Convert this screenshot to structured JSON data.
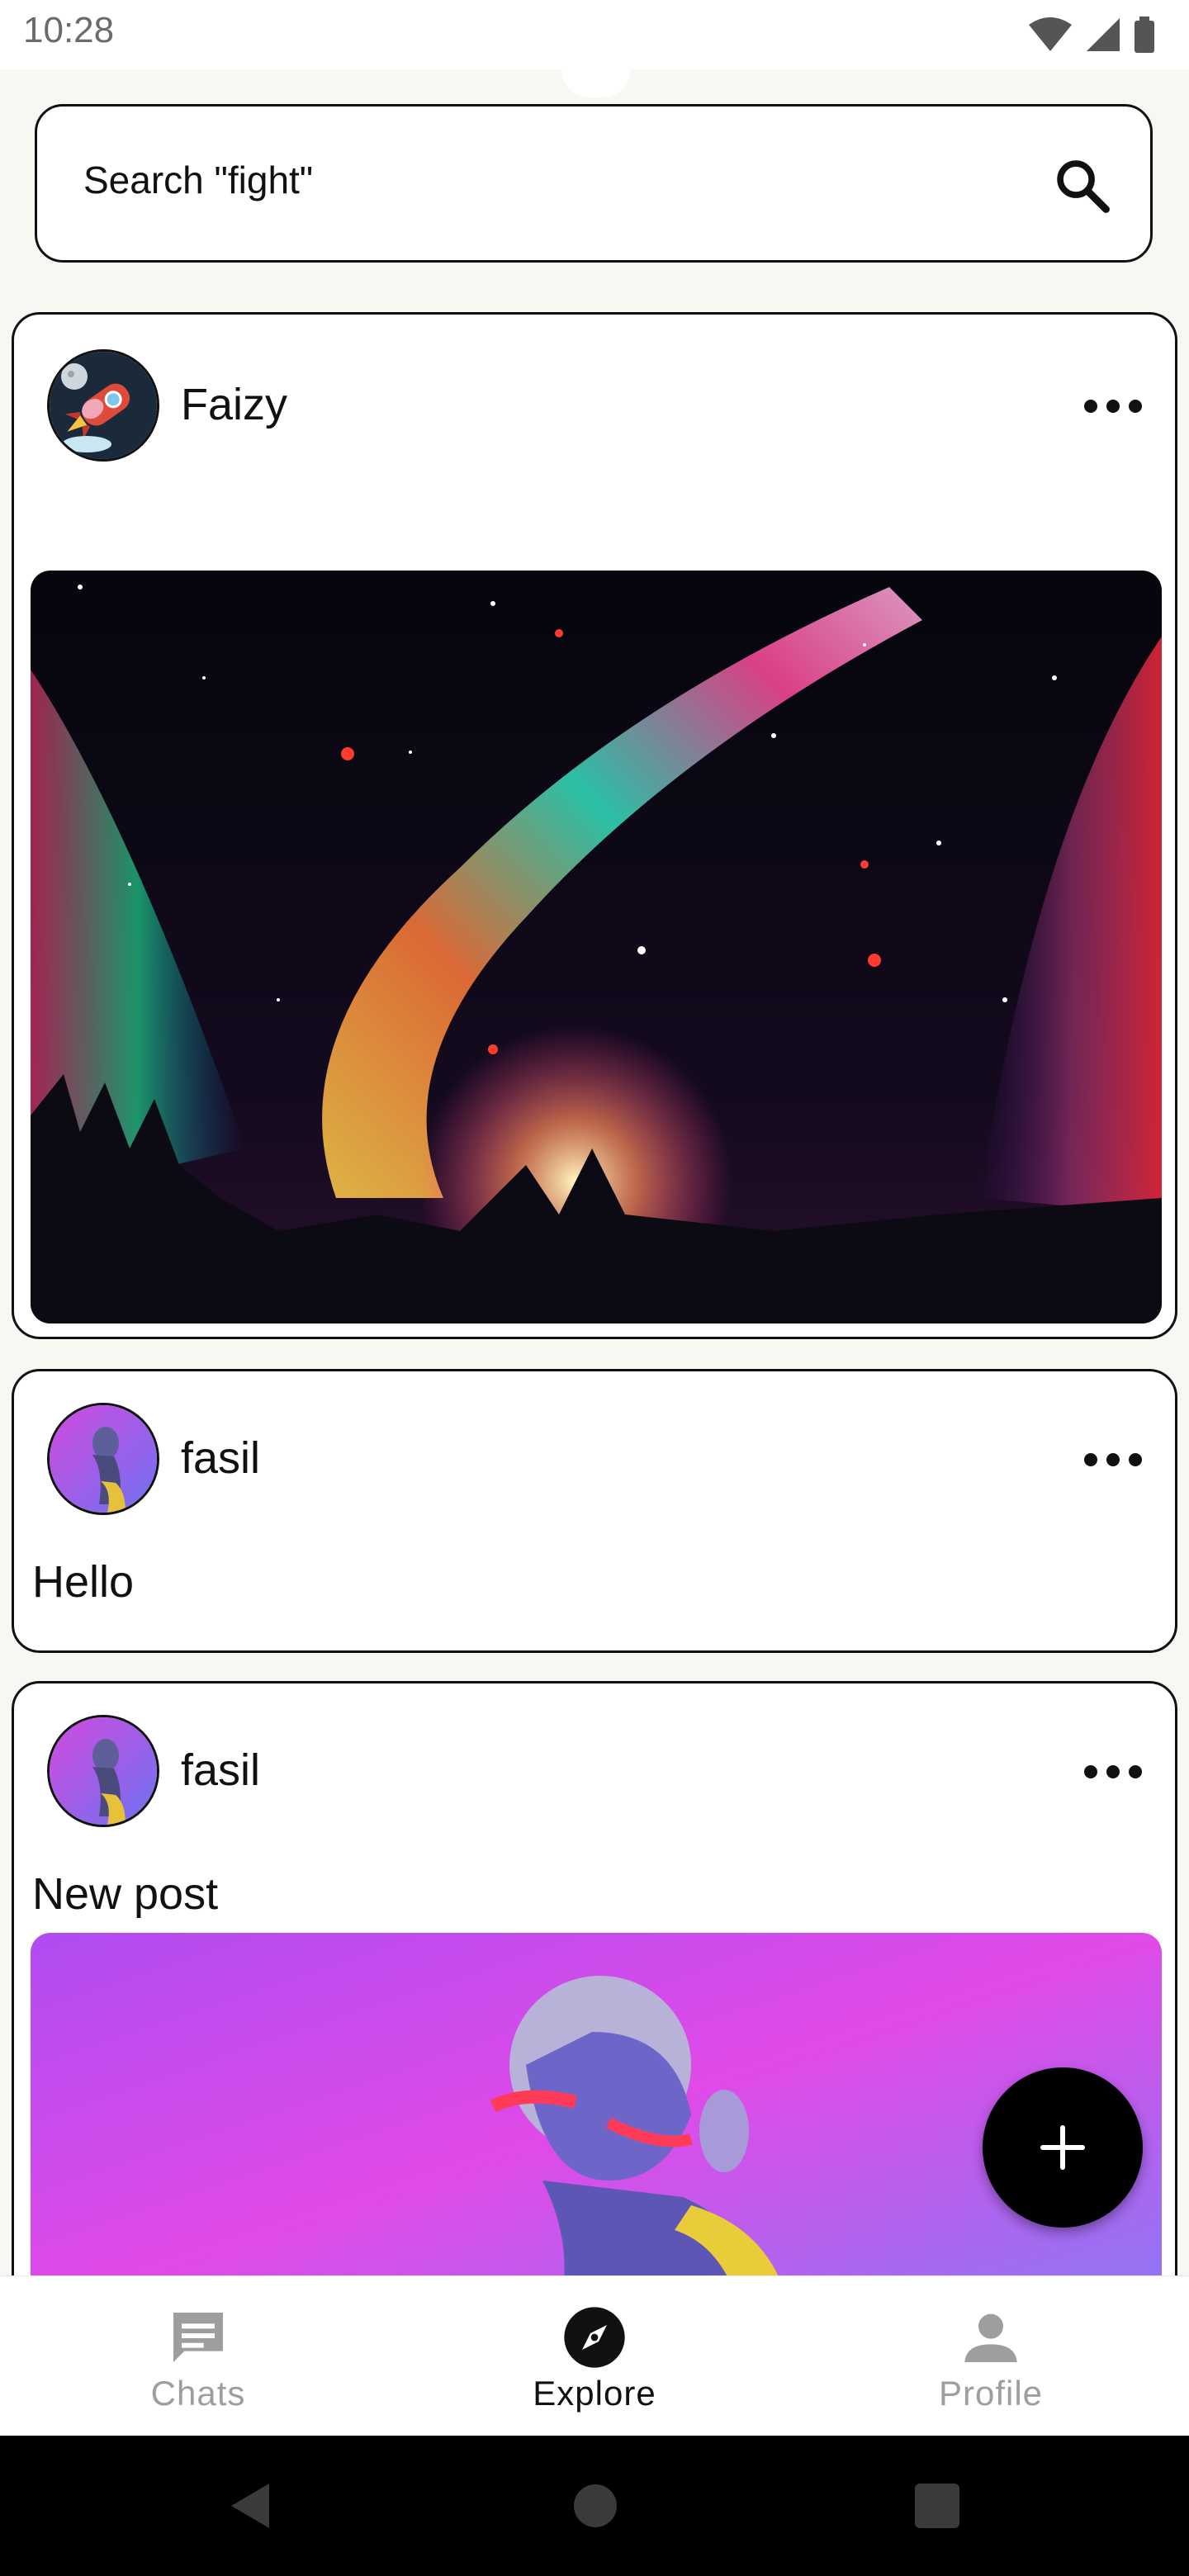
{
  "status_bar": {
    "time": "10:28"
  },
  "search": {
    "placeholder_text": "Search \"fight\""
  },
  "posts": [
    {
      "username": "Faizy",
      "text": "",
      "has_image": true
    },
    {
      "username": "fasil",
      "text": "Hello",
      "has_image": false
    },
    {
      "username": "fasil",
      "text": "New post",
      "has_image": true
    }
  ],
  "bottom_nav": {
    "items": [
      {
        "label": "Chats",
        "icon": "chat-icon",
        "active": false
      },
      {
        "label": "Explore",
        "icon": "compass-icon",
        "active": true
      },
      {
        "label": "Profile",
        "icon": "person-icon",
        "active": false
      }
    ]
  },
  "fab": {
    "icon": "plus-icon"
  },
  "colors": {
    "accent": "#000000",
    "background": "#f7f8f1",
    "inactive": "#9e9e9e"
  }
}
